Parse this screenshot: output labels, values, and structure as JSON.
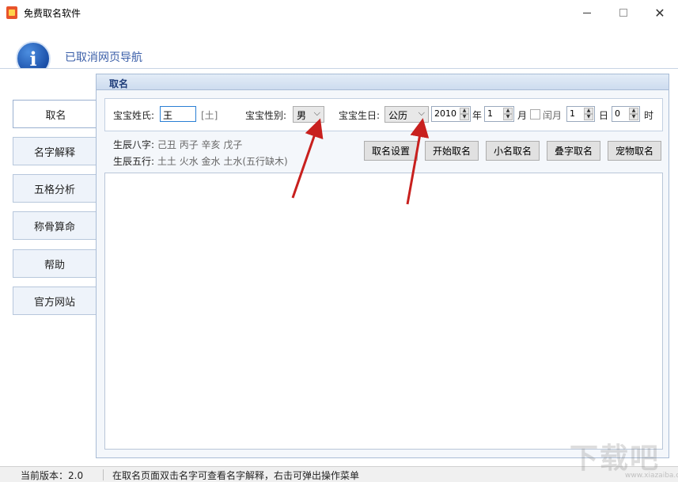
{
  "window": {
    "title": "免费取名软件",
    "minimize": "—",
    "maximize": "☐",
    "close": "✕"
  },
  "banner": {
    "icon_letter": "i",
    "text": "已取消网页导航"
  },
  "menu": [
    {
      "label": "取名",
      "active": true
    },
    {
      "label": "名字解释"
    },
    {
      "label": "五格分析"
    },
    {
      "label": "称骨算命"
    },
    {
      "label": "帮助"
    },
    {
      "label": "官方网站"
    }
  ],
  "panel": {
    "title": "取名"
  },
  "form": {
    "surname_label": "宝宝姓氏:",
    "surname_value": "王",
    "surname_element": "[土]",
    "gender_label": "宝宝性别:",
    "gender_value": "男",
    "birthday_label": "宝宝生日:",
    "calendar_value": "公历",
    "year_value": "2010",
    "year_unit": "年",
    "month_value": "1",
    "month_unit": "月",
    "leap_month_label": "闰月",
    "day_value": "1",
    "day_unit": "日",
    "hour_value": "0",
    "hour_unit": "时"
  },
  "bazi": {
    "label": "生辰八字:",
    "value": "己丑 丙子 辛亥 戊子"
  },
  "wuxing": {
    "label": "生辰五行:",
    "value": "土土 火水 金水 土水(五行缺木)"
  },
  "buttons": {
    "settings": "取名设置",
    "start": "开始取名",
    "nickname": "小名取名",
    "double": "叠字取名",
    "pet": "宠物取名"
  },
  "status": {
    "version": "当前版本：2.0",
    "hint": "在取名页面双击名字可查看名字解释，右击可弹出操作菜单"
  },
  "watermark": {
    "main": "下载吧",
    "sub": "www.xiazaiba.com"
  },
  "colors": {
    "accent": "#3a5ea8",
    "arrow": "#c8201e",
    "panel_title": "#1e3d7a"
  }
}
